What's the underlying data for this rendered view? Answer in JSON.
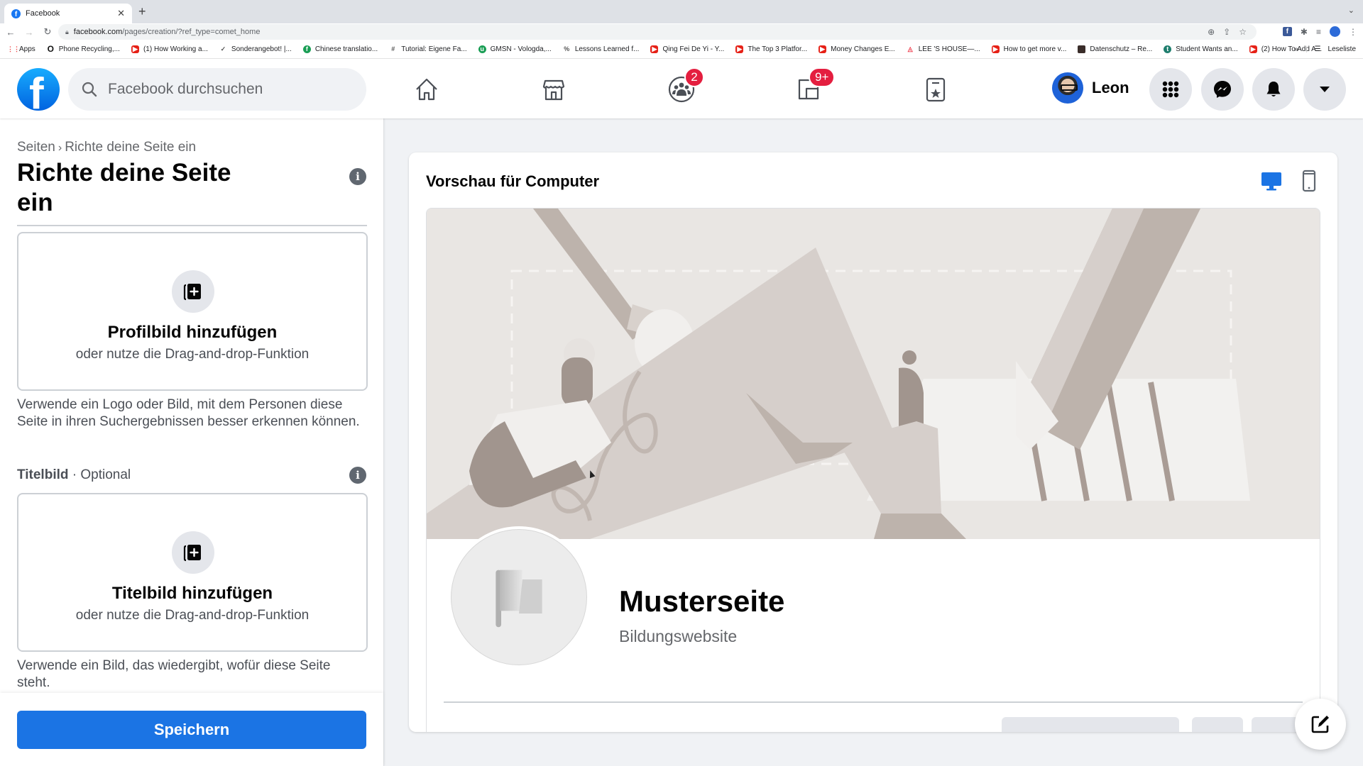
{
  "browser": {
    "tab_title": "Facebook",
    "new_tab_label": "+",
    "url_domain": "facebook.com",
    "url_path": "/pages/creation/?ref_type=comet_home",
    "bookmarks": [
      {
        "label": "Apps",
        "icon": "apps-grid-icon"
      },
      {
        "label": "Phone Recycling,...",
        "icon": "o2-icon"
      },
      {
        "label": "(1) How Working a...",
        "icon": "youtube-icon"
      },
      {
        "label": "Sonderangebot! |...",
        "icon": "check-badge-icon"
      },
      {
        "label": "Chinese translatio...",
        "icon": "fiverr-icon"
      },
      {
        "label": "Tutorial: Eigene Fa...",
        "icon": "hashtag-icon"
      },
      {
        "label": "GMSN - Vologda,...",
        "icon": "upwork-icon"
      },
      {
        "label": "Lessons Learned f...",
        "icon": "percent-icon"
      },
      {
        "label": "Qing Fei De Yi - Y...",
        "icon": "youtube-icon"
      },
      {
        "label": "The Top 3 Platfor...",
        "icon": "youtube-icon"
      },
      {
        "label": "Money Changes E...",
        "icon": "youtube-icon"
      },
      {
        "label": "LEE 'S HOUSE—...",
        "icon": "airbnb-icon"
      },
      {
        "label": "How to get more v...",
        "icon": "youtube-icon"
      },
      {
        "label": "Datenschutz – Re...",
        "icon": "site-thumbnail-icon"
      },
      {
        "label": "Student Wants an...",
        "icon": "t-circle-icon"
      },
      {
        "label": "(2) How To Add A...",
        "icon": "youtube-icon"
      }
    ],
    "more_bookmarks": "»",
    "reading_list": "Leseliste"
  },
  "header": {
    "search_placeholder": "Facebook durchsuchen",
    "groups_badge": "2",
    "gaming_badge": "9+",
    "user_name": "Leon"
  },
  "left": {
    "breadcrumb_root": "Seiten",
    "breadcrumb_sep": "›",
    "breadcrumb_current": "Richte deine Seite ein",
    "title": "Richte deine Seite ein",
    "info_glyph": "i",
    "profile_upload": {
      "title": "Profilbild hinzufügen",
      "subtitle": "oder nutze die Drag-and-drop-Funktion",
      "help": "Verwende ein Logo oder Bild, mit dem Personen diese Seite in ihren Suchergebnissen besser erkennen können."
    },
    "cover_section_label": "Titelbild",
    "cover_section_optional": " · Optional",
    "cover_upload": {
      "title": "Titelbild hinzufügen",
      "subtitle": "oder nutze die Drag-and-drop-Funktion",
      "help": "Verwende ein Bild, das wiedergibt, wofür diese Seite steht."
    },
    "save_label": "Speichern"
  },
  "preview": {
    "title": "Vorschau für Computer",
    "active_device": "desktop",
    "page_name": "Musterseite",
    "page_category": "Bildungswebsite"
  },
  "colors": {
    "brand_blue": "#1b74e4",
    "badge_red": "#e41e3f",
    "page_bg": "#f0f2f5"
  }
}
